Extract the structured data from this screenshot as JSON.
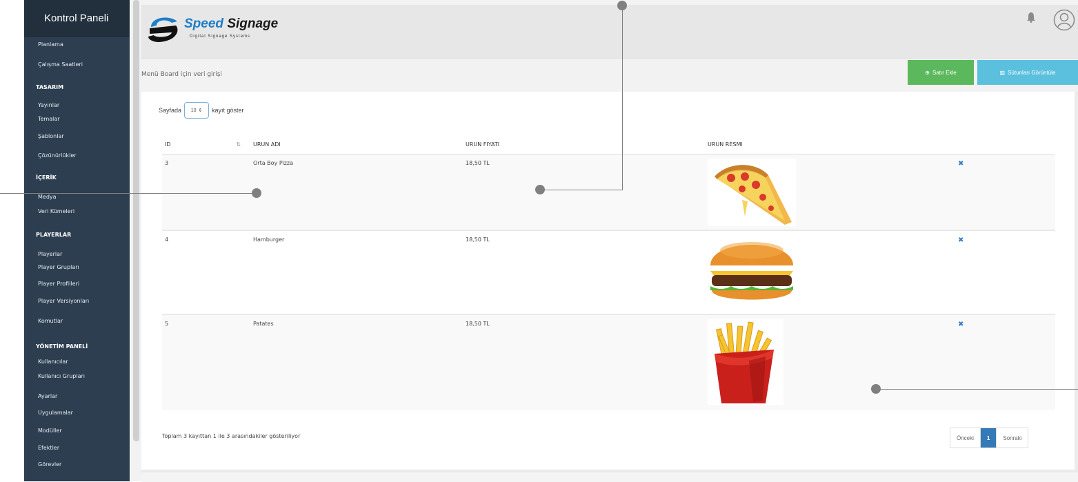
{
  "sidebar": {
    "title": "Kontrol Paneli",
    "items": [
      {
        "label": "Planlama",
        "section": false
      },
      {
        "label": "Çalışma Saatleri",
        "section": false
      },
      {
        "label": "TASARIM",
        "section": true
      },
      {
        "label": "Yayınlar",
        "section": false
      },
      {
        "label": "Temalar",
        "section": false
      },
      {
        "label": "Şablonlar",
        "section": false
      },
      {
        "label": "Çözünürlükler",
        "section": false
      },
      {
        "label": "İÇERİK",
        "section": true
      },
      {
        "label": "Medya",
        "section": false
      },
      {
        "label": "Veri Kümeleri",
        "section": false
      },
      {
        "label": "PLAYERLAR",
        "section": true
      },
      {
        "label": "Playerlar",
        "section": false
      },
      {
        "label": "Player Grupları",
        "section": false
      },
      {
        "label": "Player Profilleri",
        "section": false
      },
      {
        "label": "Player Versiyonları",
        "section": false
      },
      {
        "label": "Komutlar",
        "section": false
      },
      {
        "label": "YÖNETİM PANELİ",
        "section": true
      },
      {
        "label": "Kullanıcılar",
        "section": false
      },
      {
        "label": "Kullanıcı Grupları",
        "section": false
      },
      {
        "label": "Ayarlar",
        "section": false
      },
      {
        "label": "Uygulamalar",
        "section": false
      },
      {
        "label": "Modüller",
        "section": false
      },
      {
        "label": "Efektler",
        "section": false
      },
      {
        "label": "Görevler",
        "section": false
      }
    ]
  },
  "header": {
    "logo_word1": "Speed",
    "logo_word2": "Signage",
    "logo_tagline": "Digital Signage Systems",
    "bell_icon": "bell-icon",
    "avatar_icon": "user-icon"
  },
  "toolbar": {
    "subtitle": "Menü Board için veri girişi",
    "add_row_label": "Satır Ekle",
    "columns_label": "Sütunları Görüntüle",
    "add_row_color": "#5cb85c",
    "columns_color": "#5bc0de"
  },
  "table": {
    "length_prefix": "Sayfada",
    "length_value": "10",
    "length_suffix": "kayıt göster",
    "headers": [
      "ID",
      "URUN ADI",
      "URUN FIYATI",
      "URUN RESMI"
    ],
    "rows": [
      {
        "id": "3",
        "name": "Orta Boy Pizza",
        "price": "18,50 TL",
        "image": "pizza-slice",
        "delete": "✖"
      },
      {
        "id": "4",
        "name": "Hamburger",
        "price": "18,50 TL",
        "image": "hamburger",
        "delete": "✖"
      },
      {
        "id": "5",
        "name": "Patates",
        "price": "18,50 TL",
        "image": "french-fries",
        "delete": "✖"
      }
    ],
    "info": "Toplam 3 kayıttan 1 ile 3 arasındakiler gösteriliyor"
  },
  "pagination": {
    "prev": "Önceki",
    "current": "1",
    "next": "Sonraki",
    "active_color": "#337ab7"
  }
}
